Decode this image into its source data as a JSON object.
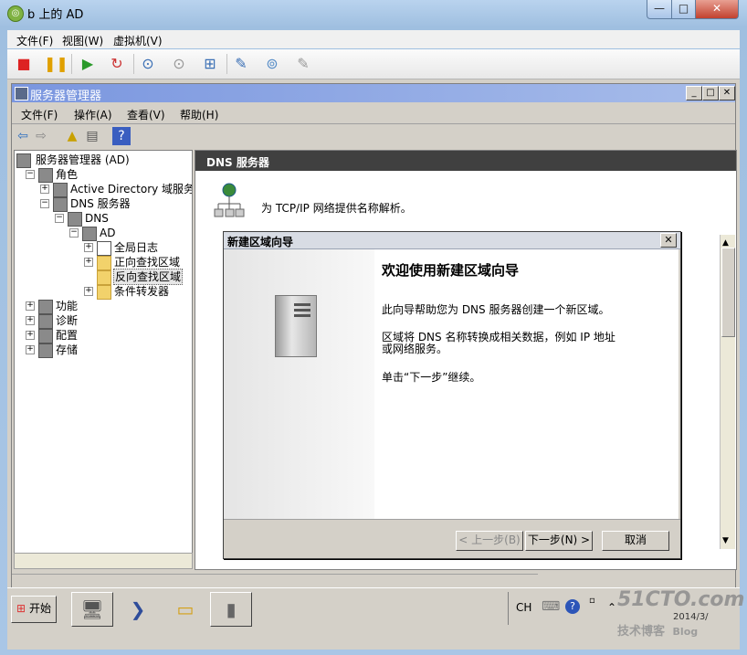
{
  "outer": {
    "title": "b 上的 AD",
    "menu": [
      "文件(F)",
      "视图(W)",
      "虚拟机(V)"
    ],
    "controls": {
      "minimize": "—",
      "maximize": "□",
      "close": "✕"
    }
  },
  "server_manager": {
    "title": "服务器管理器",
    "menu": [
      "文件(F)",
      "操作(A)",
      "查看(V)",
      "帮助(H)"
    ],
    "tree": [
      {
        "label": "服务器管理器 (AD)",
        "level": 0,
        "expander": ""
      },
      {
        "label": "角色",
        "level": 1,
        "expander": "−"
      },
      {
        "label": "Active Directory 域服务",
        "level": 2,
        "expander": "+"
      },
      {
        "label": "DNS 服务器",
        "level": 2,
        "expander": "−"
      },
      {
        "label": "DNS",
        "level": 3,
        "expander": "−"
      },
      {
        "label": "AD",
        "level": 4,
        "expander": "−"
      },
      {
        "label": "全局日志",
        "level": 5,
        "expander": "+"
      },
      {
        "label": "正向查找区域",
        "level": 5,
        "expander": "+"
      },
      {
        "label": "反向查找区域",
        "level": 5,
        "expander": "",
        "selected": true
      },
      {
        "label": "条件转发器",
        "level": 5,
        "expander": "+"
      },
      {
        "label": "功能",
        "level": 1,
        "expander": "+"
      },
      {
        "label": "诊断",
        "level": 1,
        "expander": "+"
      },
      {
        "label": "配置",
        "level": 1,
        "expander": "+"
      },
      {
        "label": "存储",
        "level": 1,
        "expander": "+"
      }
    ],
    "right_header": "DNS 服务器",
    "right_desc": "为 TCP/IP 网络提供名称解析。"
  },
  "wizard": {
    "title": "新建区域向导",
    "heading": "欢迎使用新建区域向导",
    "para1": "此向导帮助您为 DNS 服务器创建一个新区域。",
    "para2": "区域将 DNS 名称转换成相关数据，例如 IP 地址或网络服务。",
    "para3": "单击“下一步”继续。",
    "back": "< 上一步(B)",
    "next": "下一步(N) >",
    "cancel": "取消"
  },
  "taskbar": {
    "start": "开始",
    "lang": "CH",
    "time": "2014/3/"
  },
  "watermark": {
    "line1": "51CTO.com",
    "line2": "技术博客",
    "line3": "Blog"
  }
}
